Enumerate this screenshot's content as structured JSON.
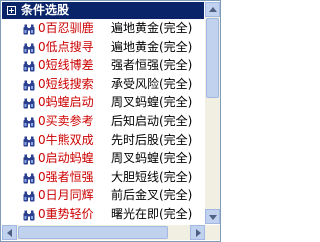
{
  "header": {
    "title": "条件选股"
  },
  "colors": {
    "header_bg": "#0a246a",
    "name_color": "#cc0000"
  },
  "rows": [
    {
      "name": "0百忍驯鹿",
      "desc": "遍地黄金(完全)"
    },
    {
      "name": "0低点搜寻",
      "desc": "遍地黄金(完全)"
    },
    {
      "name": "0短线博差",
      "desc": "强者恒强(完全)"
    },
    {
      "name": "0短线搜索",
      "desc": "承受风险(完全)"
    },
    {
      "name": "0蚂蝗启动",
      "desc": "周叉蚂蝗(完全)"
    },
    {
      "name": "0买卖参考",
      "desc": "后知启动(完全)"
    },
    {
      "name": "0牛熊双成",
      "desc": "先时后股(完全)"
    },
    {
      "name": "0启动蚂蝗",
      "desc": "周叉蚂蝗(完全)"
    },
    {
      "name": "0强者恒强",
      "desc": "大胆短线(完全)"
    },
    {
      "name": "0日月同辉",
      "desc": "前后金叉(完全)"
    },
    {
      "name": "0重势轻价",
      "desc": "曙光在即(完全)"
    }
  ],
  "icons": {
    "header": "tree-collapse-icon",
    "row": "binoculars-icon"
  }
}
